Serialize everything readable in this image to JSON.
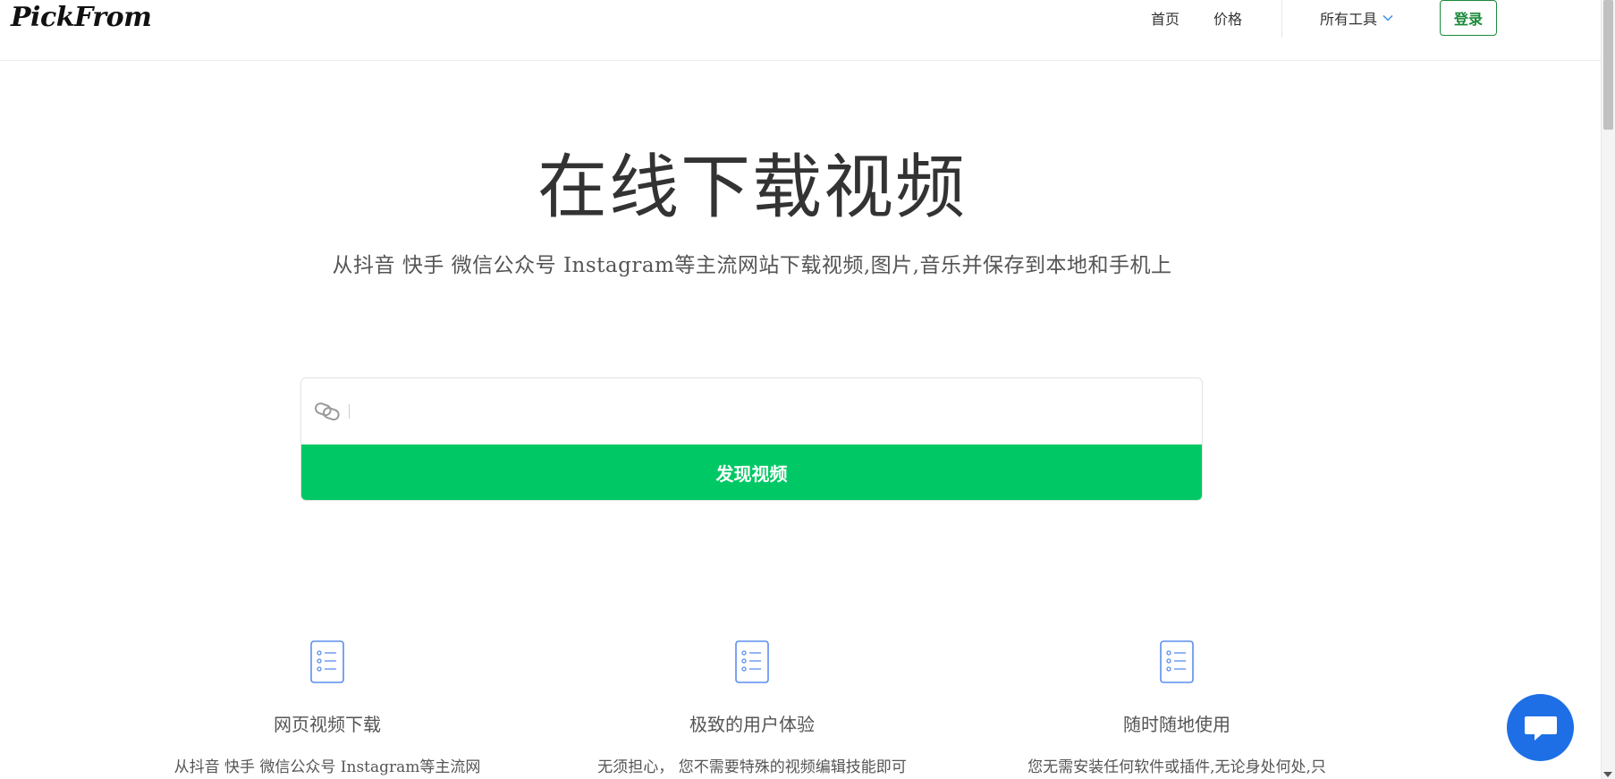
{
  "header": {
    "logo": "PickFrom",
    "nav": {
      "home": "首页",
      "pricing": "价格",
      "all_tools": "所有工具",
      "login": "登录"
    }
  },
  "hero": {
    "title": "在线下载视频",
    "subtitle": "从抖音 快手 微信公众号 Instagram等主流网站下载视频,图片,音乐并保存到本地和手机上"
  },
  "search": {
    "placeholder": "",
    "value": "",
    "button_label": "发现视频",
    "icon": "link-icon"
  },
  "features": [
    {
      "icon": "list-document-icon",
      "title": "网页视频下载",
      "desc": "从抖音 快手 微信公众号 Instagram等主流网"
    },
    {
      "icon": "list-document-icon",
      "title": "极致的用户体验",
      "desc": "无须担心， 您不需要特殊的视频编辑技能即可"
    },
    {
      "icon": "list-document-icon",
      "title": "随时随地使用",
      "desc": "您无需安装任何软件或插件,无论身处何处,只"
    }
  ],
  "chat": {
    "icon": "chat-icon"
  },
  "colors": {
    "accent_green": "#00c864",
    "login_green": "#1a8a3a",
    "chat_blue": "#1e6fe6",
    "icon_blue": "#5b8def"
  }
}
